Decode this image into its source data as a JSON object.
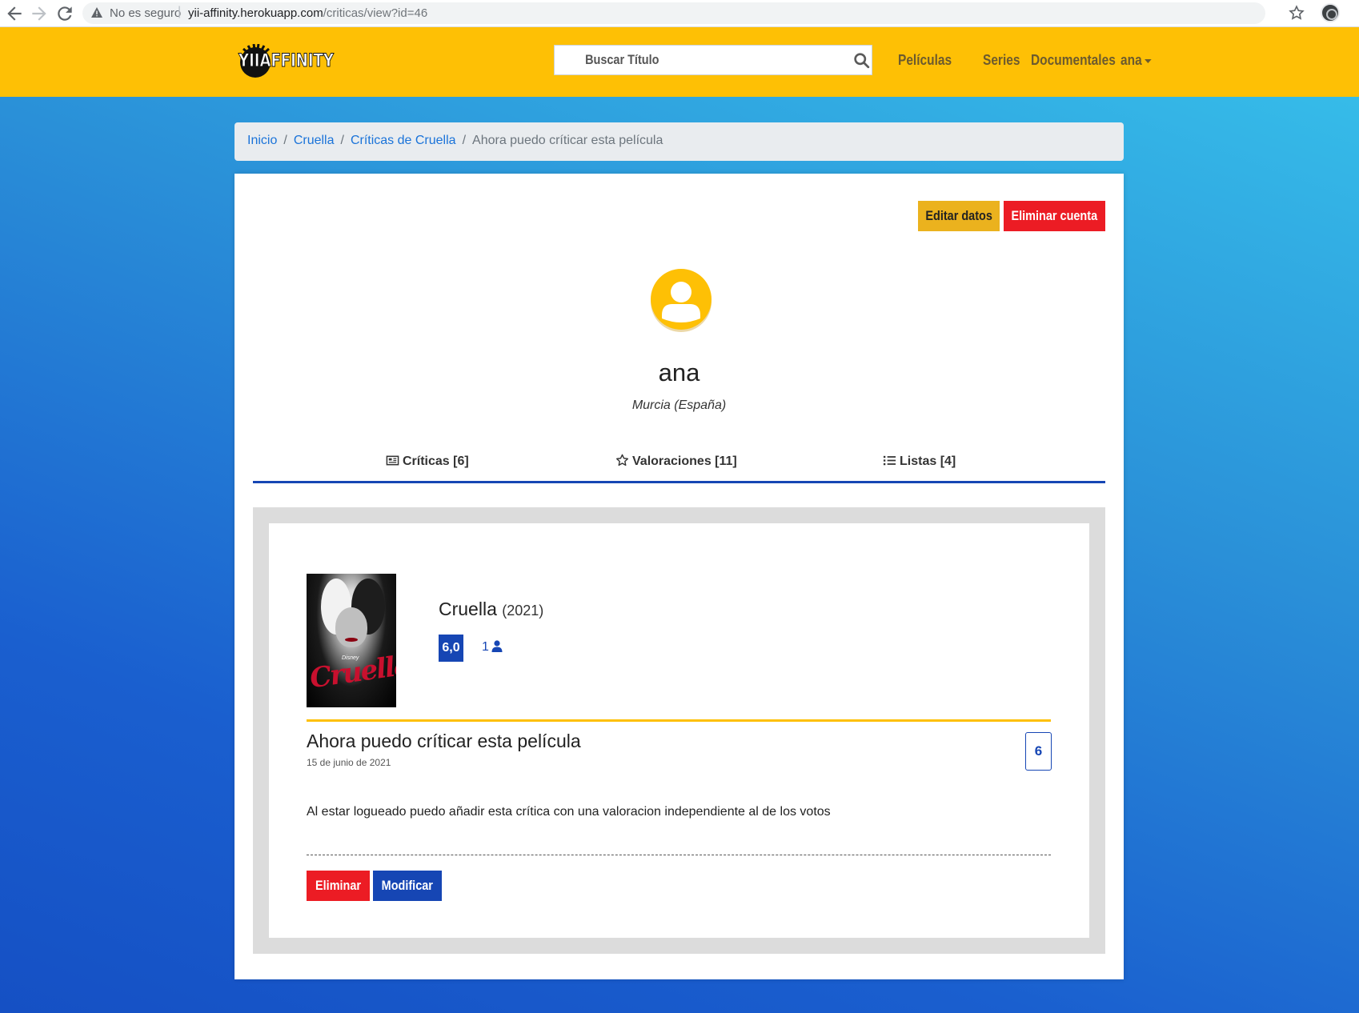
{
  "browser": {
    "insecure_label": "No es seguro",
    "url_host": "yii-affinity.herokuapp.com",
    "url_path": "/criticas/view?id=46"
  },
  "header": {
    "logo_text": "YIIAFFINITY",
    "search_placeholder": "Buscar Título",
    "nav": [
      "Películas",
      "Series",
      "Documentales"
    ],
    "user_menu": "ana",
    "bg_color": "#fec005"
  },
  "breadcrumb": {
    "items": [
      "Inicio",
      "Cruella",
      "Críticas de Cruella"
    ],
    "active": "Ahora puedo críticar esta película"
  },
  "profile": {
    "edit_button": "Editar datos",
    "delete_account_button": "Eliminar cuenta",
    "username": "ana",
    "location": "Murcia (España)",
    "tabs": [
      {
        "label": "Críticas [6]",
        "icon": "newspaper-icon"
      },
      {
        "label": "Valoraciones [11]",
        "icon": "star-icon"
      },
      {
        "label": "Listas [4]",
        "icon": "list-icon"
      }
    ]
  },
  "review": {
    "movie_title": "Cruella",
    "movie_year": "(2021)",
    "poster_text": "Cruella",
    "poster_brand": "Disney",
    "average_score": "6,0",
    "votes_count": "1",
    "title": "Ahora puedo críticar esta película",
    "date": "15 de junio de 2021",
    "score": "6",
    "body": "Al estar logueado puedo añadir esta crítica con una valoracion independiente al de los votos",
    "delete_button": "Eliminar",
    "modify_button": "Modificar"
  },
  "colors": {
    "accent_yellow": "#fec005",
    "primary_blue": "#1646b4",
    "danger_red": "#ec1c24"
  }
}
